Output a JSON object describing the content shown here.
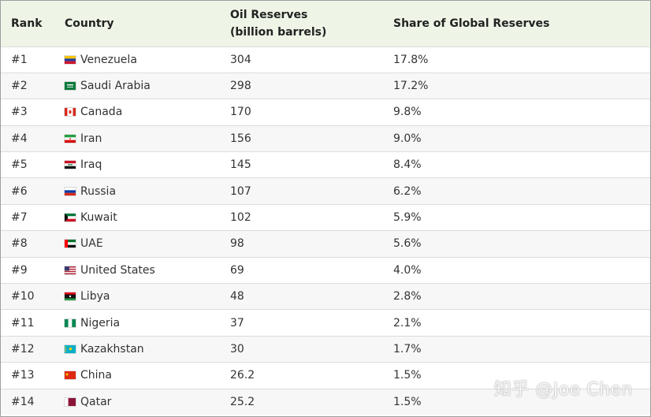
{
  "header": {
    "rank": "Rank",
    "country": "Country",
    "oil_line1": "Oil Reserves",
    "oil_line2": "(billion barrels)",
    "share": "Share of Global Reserves"
  },
  "rows": [
    {
      "rank": "#1",
      "country": "Venezuela",
      "flag": "venezuela-flag-icon",
      "oil": "304",
      "share": "17.8%"
    },
    {
      "rank": "#2",
      "country": "Saudi Arabia",
      "flag": "saudi-arabia-flag-icon",
      "oil": "298",
      "share": "17.2%"
    },
    {
      "rank": "#3",
      "country": "Canada",
      "flag": "canada-flag-icon",
      "oil": "170",
      "share": "9.8%"
    },
    {
      "rank": "#4",
      "country": "Iran",
      "flag": "iran-flag-icon",
      "oil": "156",
      "share": "9.0%"
    },
    {
      "rank": "#5",
      "country": "Iraq",
      "flag": "iraq-flag-icon",
      "oil": "145",
      "share": "8.4%"
    },
    {
      "rank": "#6",
      "country": "Russia",
      "flag": "russia-flag-icon",
      "oil": "107",
      "share": "6.2%"
    },
    {
      "rank": "#7",
      "country": "Kuwait",
      "flag": "kuwait-flag-icon",
      "oil": "102",
      "share": "5.9%"
    },
    {
      "rank": "#8",
      "country": "UAE",
      "flag": "uae-flag-icon",
      "oil": "98",
      "share": "5.6%"
    },
    {
      "rank": "#9",
      "country": "United States",
      "flag": "united-states-flag-icon",
      "oil": "69",
      "share": "4.0%"
    },
    {
      "rank": "#10",
      "country": "Libya",
      "flag": "libya-flag-icon",
      "oil": "48",
      "share": "2.8%"
    },
    {
      "rank": "#11",
      "country": "Nigeria",
      "flag": "nigeria-flag-icon",
      "oil": "37",
      "share": "2.1%"
    },
    {
      "rank": "#12",
      "country": "Kazakhstan",
      "flag": "kazakhstan-flag-icon",
      "oil": "30",
      "share": "1.7%"
    },
    {
      "rank": "#13",
      "country": "China",
      "flag": "china-flag-icon",
      "oil": "26.2",
      "share": "1.5%"
    },
    {
      "rank": "#14",
      "country": "Qatar",
      "flag": "qatar-flag-icon",
      "oil": "25.2",
      "share": "1.5%"
    }
  ],
  "colors": {
    "header_bg": "#eef5e7",
    "row_alt_bg": "#f7f7f7",
    "border": "#dcdcdc"
  },
  "watermark": "知乎 @Joe Chen"
}
